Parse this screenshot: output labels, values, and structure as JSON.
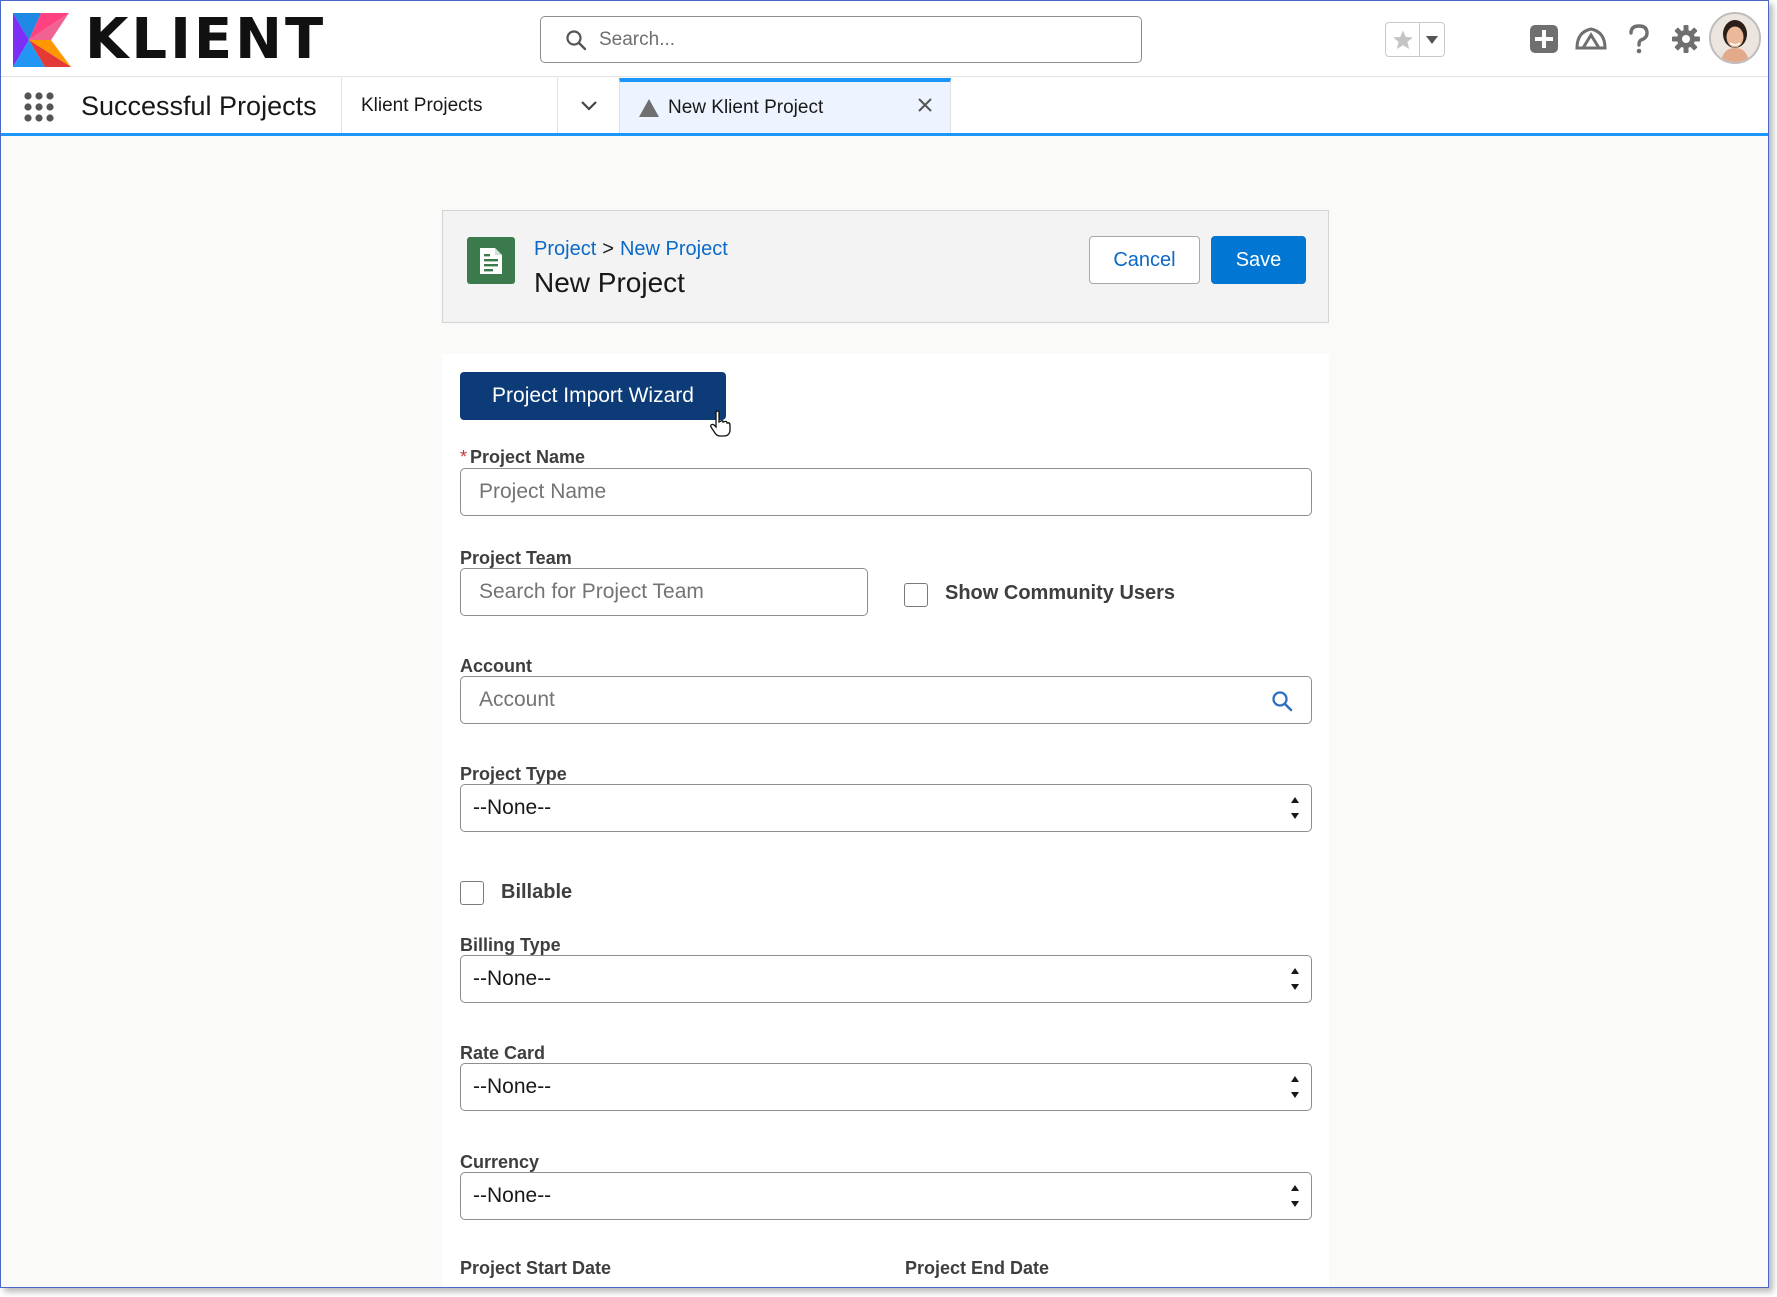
{
  "header": {
    "logo_text": "KLIENT",
    "search_placeholder": "Search..."
  },
  "nav": {
    "app_name": "Successful Projects",
    "tabs": [
      {
        "label": "Klient Projects"
      },
      {
        "label": "New Klient Project"
      }
    ]
  },
  "page_header": {
    "breadcrumb": {
      "parent": "Project",
      "separator": ">",
      "current": "New Project"
    },
    "title": "New Project",
    "cancel_label": "Cancel",
    "save_label": "Save"
  },
  "form": {
    "wizard_label": "Project Import Wizard",
    "project_name": {
      "required_mark": "*",
      "label": "Project Name",
      "placeholder": "Project Name",
      "value": ""
    },
    "project_team": {
      "label": "Project Team",
      "placeholder": "Search for Project Team",
      "value": ""
    },
    "show_community_users": {
      "label": "Show Community Users",
      "checked": false
    },
    "account": {
      "label": "Account",
      "placeholder": "Account",
      "value": ""
    },
    "project_type": {
      "label": "Project Type",
      "value": "--None--"
    },
    "billable": {
      "label": "Billable",
      "checked": false
    },
    "billing_type": {
      "label": "Billing Type",
      "value": "--None--"
    },
    "rate_card": {
      "label": "Rate Card",
      "value": "--None--"
    },
    "currency": {
      "label": "Currency",
      "value": "--None--"
    },
    "project_start_date": {
      "label": "Project Start Date"
    },
    "project_end_date": {
      "label": "Project End Date"
    }
  },
  "colors": {
    "brand_blue": "#0176d3",
    "link_blue": "#0b69c7",
    "wizard_navy": "#0c3b78",
    "active_tab_accent": "#1b96ff",
    "record_icon_green": "#3b7a4d"
  }
}
